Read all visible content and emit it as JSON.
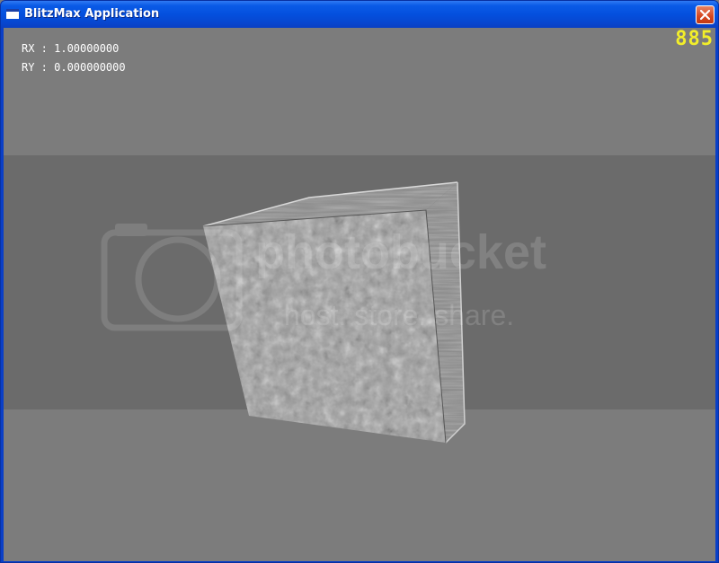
{
  "window": {
    "title": "BlitzMax Application"
  },
  "hud": {
    "rx_line": "RX : 1.00000000",
    "ry_line": "RY : 0.000000000",
    "fps": "885",
    "fps_color": "#f2ee2a"
  },
  "scene": {
    "background_color": "#7c7c7c",
    "band_color": "#6b6b6b",
    "object": "textured-cube"
  },
  "watermark": {
    "logo_text": "photobucket",
    "tagline": "host. store. share."
  }
}
